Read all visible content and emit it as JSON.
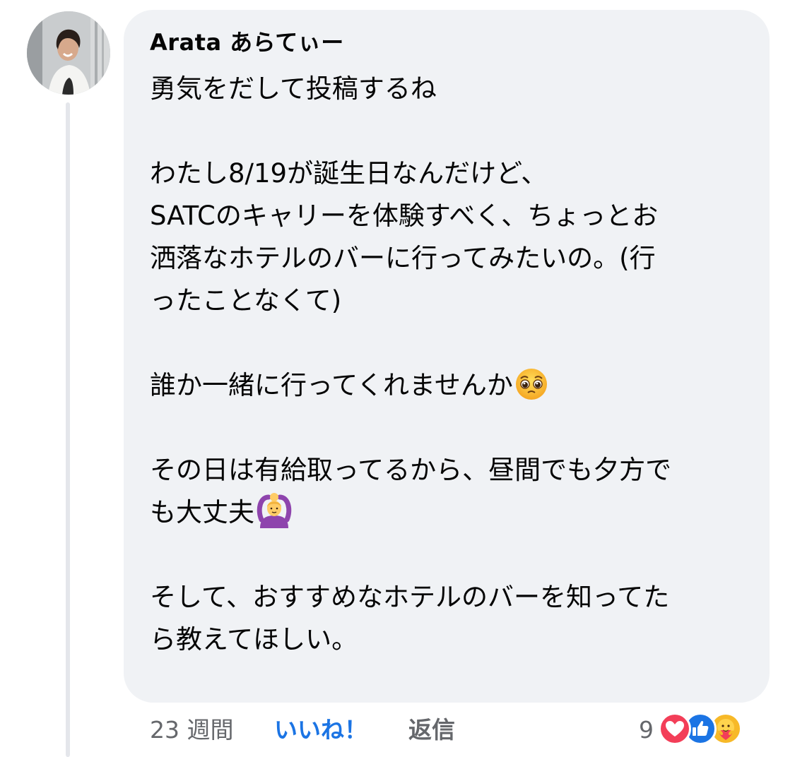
{
  "comment": {
    "author": "Arata あらてぃー",
    "lines": [
      "勇気をだして投稿するね",
      "",
      "わたし8/19が誕生日なんだけど、",
      "SATCのキャリーを体験すべく、ちょっとお",
      "洒落なホテルのバーに行ってみたいの。(行",
      "ったことなくて)",
      "",
      "誰か一緒に行ってくれませんか",
      "",
      "その日は有給取ってるから、昼間でも夕方で",
      "も大丈夫",
      "",
      "そして、おすすめなホテルのバーを知ってた",
      "ら教えてほしい。"
    ],
    "emoji_pleading": "pleading-face-icon",
    "emoji_ok_gesture": "person-gesturing-ok-icon"
  },
  "actions": {
    "timestamp": "23 週間",
    "like_label": "いいね！",
    "reply_label": "返信"
  },
  "reactions": {
    "count": "9",
    "icons": [
      "love-reaction-icon",
      "like-reaction-icon",
      "care-reaction-icon"
    ]
  },
  "colors": {
    "bubble_bg": "#f0f2f5",
    "text": "#050505",
    "meta": "#65676b",
    "like_blue": "#1b74e4",
    "love_red": "#f33e58"
  }
}
